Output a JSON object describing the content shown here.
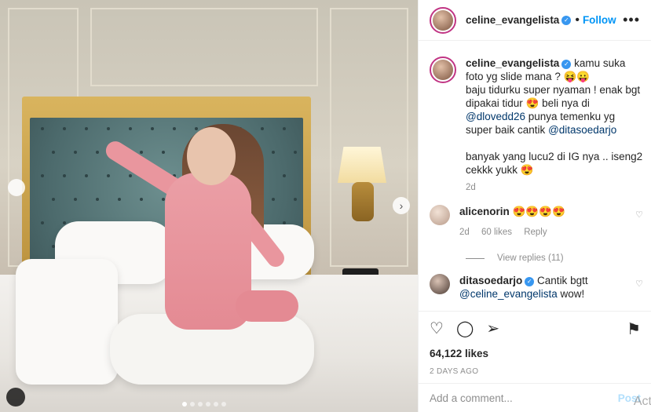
{
  "post": {
    "username": "celine_evangelista",
    "follow_label": "Follow",
    "more_icon": "more-dots-icon",
    "carousel_dot_count": 6
  },
  "caption": {
    "username": "celine_evangelista",
    "line1": "kamu suka foto yg slide mana ? 😝😛",
    "line2a": "baju tidurku super nyaman ! enak bgt dipakai tidur 😍 beli nya di ",
    "mention1": "@dlovedd26",
    "line2b": " punya temenku yg super baik cantik ",
    "mention2": "@ditasoedarjo",
    "line3": "banyak yang lucu2 di IG nya .. iseng2 cekkk yukk 😍",
    "time": "2d"
  },
  "comments": [
    {
      "username": "alicenorin",
      "text": "😍😍😍😍",
      "time": "2d",
      "likes": "60 likes",
      "reply": "Reply",
      "view_replies": "View replies (11)"
    },
    {
      "username": "ditasoedarjo",
      "text": "Cantik bgtt",
      "mention": "@celine_evangelista",
      "text2": " wow!"
    }
  ],
  "actions": {
    "likes": "64,122 likes",
    "date": "2 DAYS AGO"
  },
  "add_comment": {
    "placeholder": "Add a comment...",
    "post_label": "Post",
    "overlay": "Act"
  }
}
